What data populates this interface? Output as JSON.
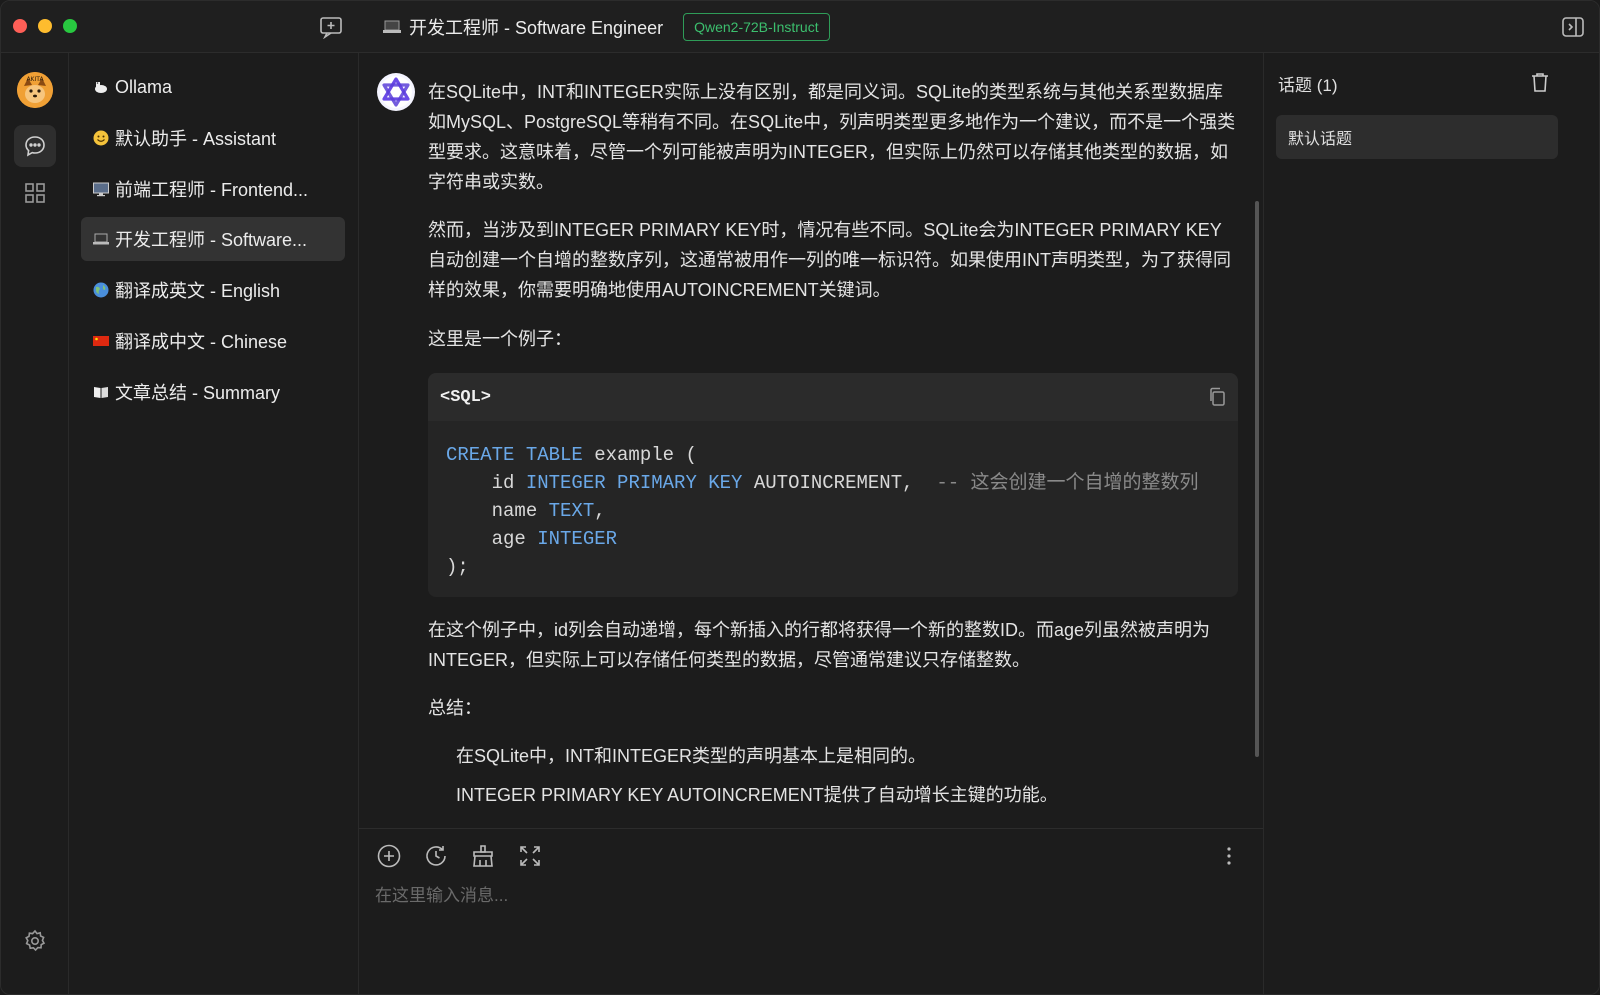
{
  "window": {
    "title": "开发工程师 - Software Engineer",
    "model_badge": "Qwen2-72B-Instruct"
  },
  "rail": {
    "avatar_text": "AKITA",
    "icons": [
      "chat-icon",
      "apps-grid-icon",
      "settings-icon"
    ]
  },
  "assistants": {
    "items": [
      {
        "emoji": "llama",
        "label": "Ollama"
      },
      {
        "emoji": "smile",
        "label": "默认助手 - Assistant"
      },
      {
        "emoji": "monitor",
        "label": "前端工程师 - Frontend..."
      },
      {
        "emoji": "laptop",
        "label": "开发工程师 - Software...",
        "active": true
      },
      {
        "emoji": "globe",
        "label": "翻译成英文 - English"
      },
      {
        "emoji": "china-flag",
        "label": "翻译成中文 - Chinese"
      },
      {
        "emoji": "book",
        "label": "文章总结 - Summary"
      }
    ]
  },
  "chat": {
    "p1": "在SQLite中，INT和INTEGER实际上没有区别，都是同义词。SQLite的类型系统与其他关系型数据库如MySQL、PostgreSQL等稍有不同。在SQLite中，列声明类型更多地作为一个建议，而不是一个强类型要求。这意味着，尽管一个列可能被声明为INTEGER，但实际上仍然可以存储其他类型的数据，如字符串或实数。",
    "p2": "然而，当涉及到INTEGER PRIMARY KEY时，情况有些不同。SQLite会为INTEGER PRIMARY KEY自动创建一个自增的整数序列，这通常被用作一列的唯一标识符。如果使用INT声明类型，为了获得同样的效果，你需要明确地使用AUTOINCREMENT关键词。",
    "p3": "这里是一个例子：",
    "code_lang": "<SQL>",
    "code": {
      "l1_kw": "CREATE TABLE",
      "l1_rest": " example (",
      "l2_pre": "    id ",
      "l2_kw": "INTEGER PRIMARY KEY",
      "l2_rest": " AUTOINCREMENT,  ",
      "l2_comment": "-- 这会创建一个自增的整数列",
      "l3_pre": "    name ",
      "l3_kw": "TEXT",
      "l3_rest": ",",
      "l4_pre": "    age ",
      "l4_kw": "INTEGER",
      "l5": ");"
    },
    "p4": "在这个例子中，id列会自动递增，每个新插入的行都将获得一个新的整数ID。而age列虽然被声明为INTEGER，但实际上可以存储任何类型的数据，尽管通常建议只存储整数。",
    "p5": "总结：",
    "li1": "在SQLite中，INT和INTEGER类型的声明基本上是相同的。",
    "li2": "INTEGER PRIMARY KEY AUTOINCREMENT提供了自动增长主键的功能。"
  },
  "input": {
    "placeholder": "在这里输入消息...",
    "tools": [
      "add-icon",
      "history-icon",
      "clear-icon",
      "expand-icon",
      "more-icon"
    ]
  },
  "topics": {
    "title": "话题 (1)",
    "items": [
      "默认话题"
    ]
  }
}
